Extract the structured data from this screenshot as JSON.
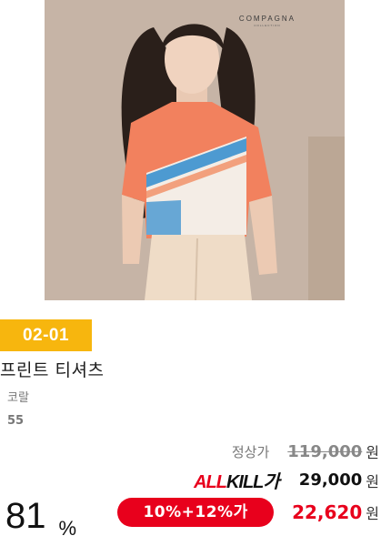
{
  "product": {
    "image_brand": "COMPAGNA",
    "image_brand_sub": "COLLECTION",
    "badge": "02-01",
    "title": "프린트 티셔츠",
    "color": "코랄",
    "size": "55"
  },
  "price": {
    "regular_label": "정상가",
    "regular_value": "119,000",
    "allkill_label_a": "ALL",
    "allkill_label_b": "KILL",
    "allkill_label_c": "가",
    "allkill_value": "29,000",
    "discount_badge": "10%+12%가",
    "final_value": "22,620",
    "currency": "원"
  },
  "discount": {
    "percent": "81",
    "sign": "%"
  },
  "colors": {
    "badge": "#f7b60e",
    "accent_red": "#e8001c",
    "shirt": "#f2815e"
  }
}
